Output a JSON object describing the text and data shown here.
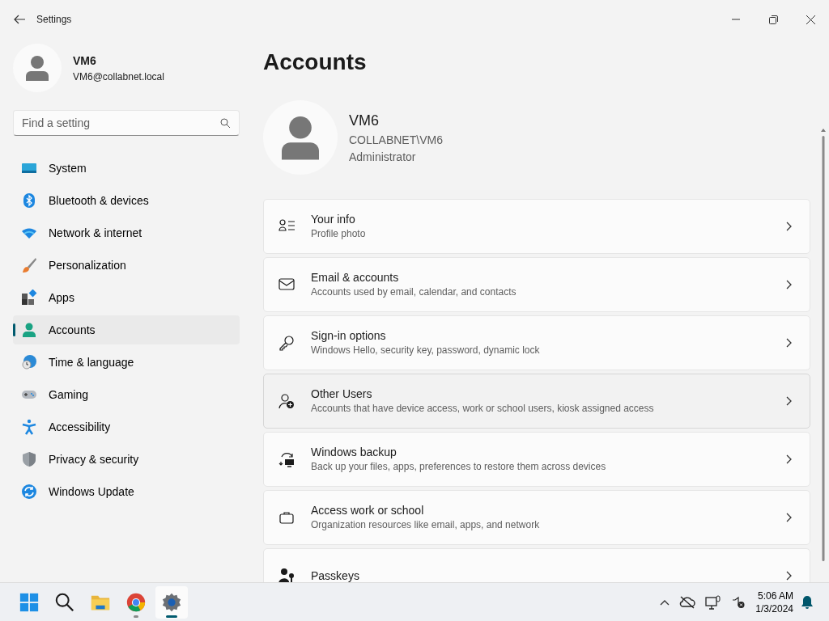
{
  "window": {
    "title": "Settings"
  },
  "profile": {
    "name": "VM6",
    "email": "VM6@collabnet.local"
  },
  "search": {
    "placeholder": "Find a setting"
  },
  "sidebar": {
    "items": [
      {
        "label": "System",
        "selected": false
      },
      {
        "label": "Bluetooth & devices",
        "selected": false
      },
      {
        "label": "Network & internet",
        "selected": false
      },
      {
        "label": "Personalization",
        "selected": false
      },
      {
        "label": "Apps",
        "selected": false
      },
      {
        "label": "Accounts",
        "selected": true
      },
      {
        "label": "Time & language",
        "selected": false
      },
      {
        "label": "Gaming",
        "selected": false
      },
      {
        "label": "Accessibility",
        "selected": false
      },
      {
        "label": "Privacy & security",
        "selected": false
      },
      {
        "label": "Windows Update",
        "selected": false
      }
    ]
  },
  "page": {
    "title": "Accounts",
    "user": {
      "name": "VM6",
      "account": "COLLABNET\\VM6",
      "role": "Administrator"
    },
    "cards": [
      {
        "title": "Your info",
        "subtitle": "Profile photo",
        "hovered": false
      },
      {
        "title": "Email & accounts",
        "subtitle": "Accounts used by email, calendar, and contacts",
        "hovered": false
      },
      {
        "title": "Sign-in options",
        "subtitle": "Windows Hello, security key, password, dynamic lock",
        "hovered": false
      },
      {
        "title": "Other Users",
        "subtitle": "Accounts that have device access, work or school users, kiosk assigned access",
        "hovered": true
      },
      {
        "title": "Windows backup",
        "subtitle": "Back up your files, apps, preferences to restore them across devices",
        "hovered": false
      },
      {
        "title": "Access work or school",
        "subtitle": "Organization resources like email, apps, and network",
        "hovered": false
      },
      {
        "title": "Passkeys",
        "hovered": false
      }
    ]
  },
  "taskbar": {
    "apps": [
      {
        "running": false,
        "active": false
      },
      {
        "running": false,
        "active": false
      },
      {
        "running": false,
        "active": false
      },
      {
        "running": true,
        "active": false
      },
      {
        "running": true,
        "active": true
      }
    ],
    "time": "5:06 AM",
    "date": "1/3/2024"
  }
}
